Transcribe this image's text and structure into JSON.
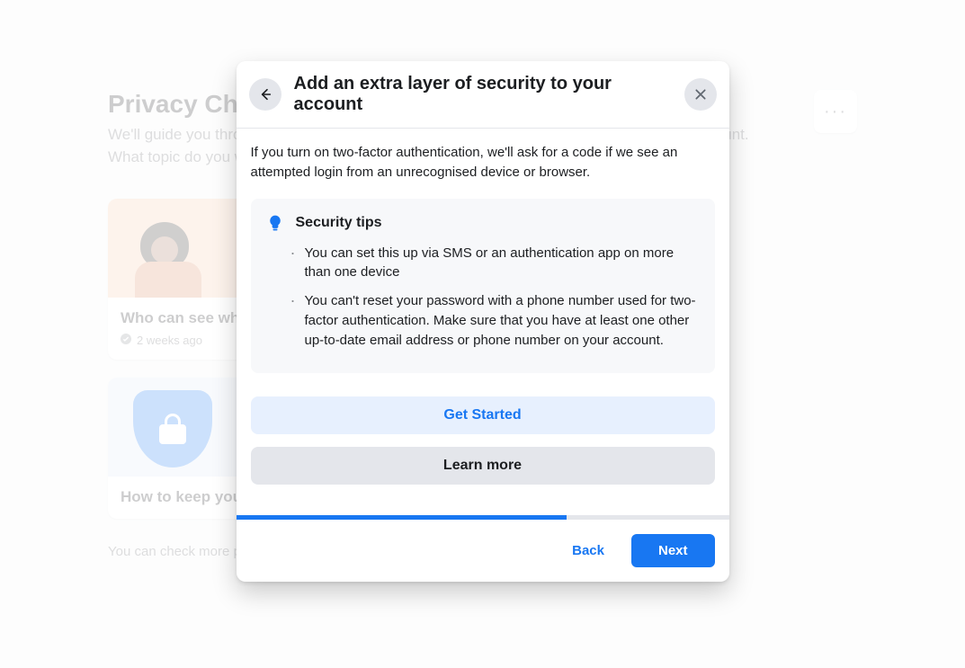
{
  "background": {
    "title": "Privacy Checkup",
    "subtitle": "We'll guide you through some settings so that you can make the right choices for your account. What topic do you want to start with?",
    "menu_glyph": "···",
    "footer_note": "You can check more privacy settings on Facebook in Settings.",
    "cards": [
      {
        "title": "Who can see what you share",
        "meta": "2 weeks ago"
      },
      {
        "title": "How to keep your account secure",
        "meta": ""
      }
    ]
  },
  "modal": {
    "title": "Add an extra layer of security to your account",
    "description": "If you turn on two-factor authentication, we'll ask for a code if we see an attempted login from an unrecognised device or browser.",
    "tips_title": "Security tips",
    "tips": [
      "You can set this up via SMS or an authentication app on more than one device",
      "You can't reset your password with a phone number used for two-factor authentication. Make sure that you have at least one other up-to-date email address or phone number on your account."
    ],
    "get_started_label": "Get Started",
    "learn_more_label": "Learn more",
    "back_label": "Back",
    "next_label": "Next",
    "progress_percent": 67
  }
}
